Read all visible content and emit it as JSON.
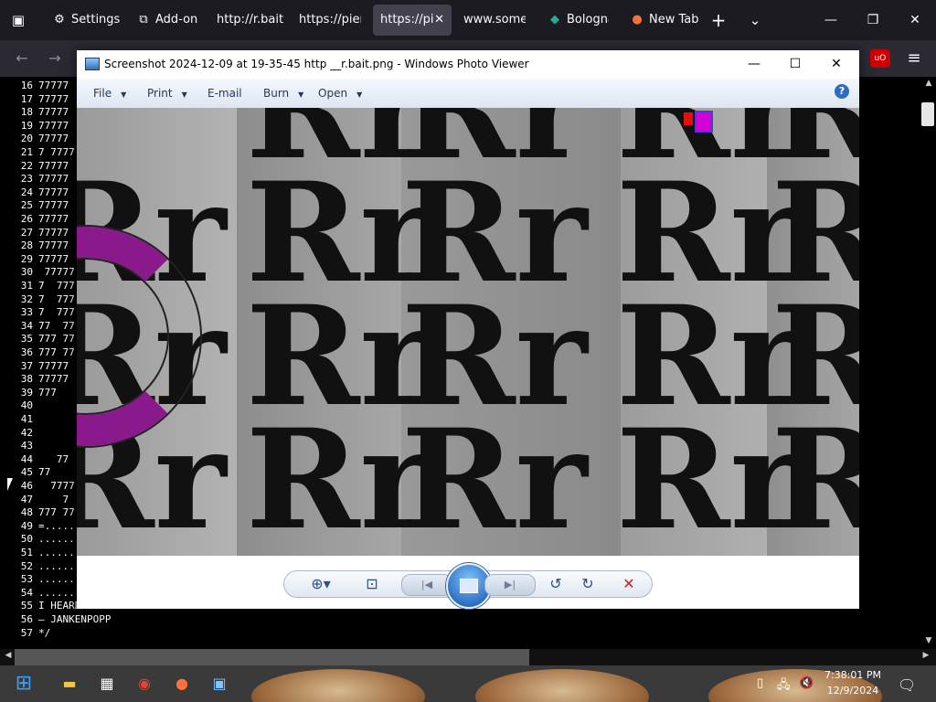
{
  "browser": {
    "toolbar_icons": [
      "tab-overview-icon"
    ],
    "tabs": [
      {
        "label": "Settings",
        "icon": "gear-icon",
        "active": false
      },
      {
        "label": "Add-ons",
        "icon": "puzzle-icon",
        "active": false
      },
      {
        "label": "http://r.bait",
        "icon": "",
        "active": false
      },
      {
        "label": "https://pien",
        "icon": "",
        "active": false
      },
      {
        "label": "https://pi",
        "icon": "",
        "active": true,
        "close": "✕"
      },
      {
        "label": "www.somer",
        "icon": "",
        "active": false
      },
      {
        "label": "Bologna",
        "icon": "globe-icon",
        "active": false
      },
      {
        "label": "New Tab",
        "icon": "firefox-icon",
        "active": false
      }
    ],
    "new_tab": "+",
    "list_tabs": "⌄",
    "window_controls": {
      "minimize": "—",
      "maximize": "❐",
      "close": "✕"
    },
    "nav": {
      "back": "←",
      "forward": "→",
      "menu": "≡",
      "extension": "uO"
    }
  },
  "code": {
    "lines": [
      {
        "n": "16",
        "t": "77777"
      },
      {
        "n": "17",
        "t": "77777"
      },
      {
        "n": "18",
        "t": "77777"
      },
      {
        "n": "19",
        "t": "77777"
      },
      {
        "n": "20",
        "t": "77777"
      },
      {
        "n": "21",
        "t": "7 7777"
      },
      {
        "n": "22",
        "t": "77777"
      },
      {
        "n": "23",
        "t": "77777"
      },
      {
        "n": "24",
        "t": "77777"
      },
      {
        "n": "25",
        "t": "77777"
      },
      {
        "n": "26",
        "t": "77777"
      },
      {
        "n": "27",
        "t": "77777"
      },
      {
        "n": "28",
        "t": "77777"
      },
      {
        "n": "29",
        "t": "77777"
      },
      {
        "n": "30",
        "t": " 77777"
      },
      {
        "n": "31",
        "t": "7  777"
      },
      {
        "n": "32",
        "t": "7  777"
      },
      {
        "n": "33",
        "t": "7  777"
      },
      {
        "n": "34",
        "t": "77  77"
      },
      {
        "n": "35",
        "t": "777 77"
      },
      {
        "n": "36",
        "t": "777 77"
      },
      {
        "n": "37",
        "t": "77777"
      },
      {
        "n": "38",
        "t": "77777"
      },
      {
        "n": "39",
        "t": "777"
      },
      {
        "n": "40",
        "t": ""
      },
      {
        "n": "41",
        "t": ""
      },
      {
        "n": "42",
        "t": ""
      },
      {
        "n": "43",
        "t": ""
      },
      {
        "n": "44",
        "t": "   77"
      },
      {
        "n": "45",
        "t": "77"
      },
      {
        "n": "46",
        "t": "  7777"
      },
      {
        "n": "47",
        "t": "    7"
      },
      {
        "n": "48",
        "t": "777 77"
      },
      {
        "n": "49",
        "t": "=....."
      },
      {
        "n": "50",
        "t": "......"
      },
      {
        "n": "51",
        "t": "......"
      },
      {
        "n": "52",
        "t": "......"
      },
      {
        "n": "53",
        "t": "......"
      },
      {
        "n": "54",
        "t": "......"
      },
      {
        "n": "55",
        "t": "I HEARD YOU LIKE THE INTERNET SO I PUT AN INTERNET IN YO INTERNET SO U CAN SURF TEH INTERNET WHILE U SURF TEH INTERNET"
      },
      {
        "n": "56",
        "t": "— JANKENPOPP"
      },
      {
        "n": "57",
        "t": "*/"
      }
    ]
  },
  "viewer": {
    "title": "Screenshot 2024-12-09 at 19-35-45 http __r.bait.png - Windows Photo Viewer",
    "window_controls": {
      "minimize": "—",
      "maximize": "☐",
      "close": "✕"
    },
    "menu": [
      {
        "label": "File",
        "arrow": "▼"
      },
      {
        "label": "Print",
        "arrow": "▼"
      },
      {
        "label": "E-mail",
        "arrow": ""
      },
      {
        "label": "Burn",
        "arrow": "▼"
      },
      {
        "label": "Open",
        "arrow": "▼"
      }
    ],
    "help": "?",
    "image_text": {
      "rr": "Rr",
      "r": "R"
    },
    "controls": {
      "zoom": "⊕▾",
      "actual_size": "⊡",
      "previous": "|◀",
      "next": "▶|",
      "rotate_ccw": "↺",
      "rotate_cw": "↻",
      "delete": "✕"
    }
  },
  "taskbar": {
    "time": "7:38:01 PM",
    "date": "12/9/2024",
    "apps": [
      {
        "name": "windows-start-icon",
        "glyph": "⊞"
      },
      {
        "name": "file-explorer-icon",
        "glyph": "▬"
      },
      {
        "name": "microsoft-store-icon",
        "glyph": "▦"
      },
      {
        "name": "chrome-icon",
        "glyph": "◉"
      },
      {
        "name": "firefox-icon",
        "glyph": "●"
      },
      {
        "name": "photo-viewer-icon",
        "glyph": "▣"
      }
    ],
    "tray": {
      "usb": "▯",
      "network": "🖧",
      "volume": "🔇",
      "notifications": "🗨"
    }
  },
  "colors": {
    "browser_bg": "#1c1b22",
    "active_tab": "#42414d",
    "purple": "#8a1a8c",
    "magenta": "#d400d4",
    "red": "#e21010"
  }
}
